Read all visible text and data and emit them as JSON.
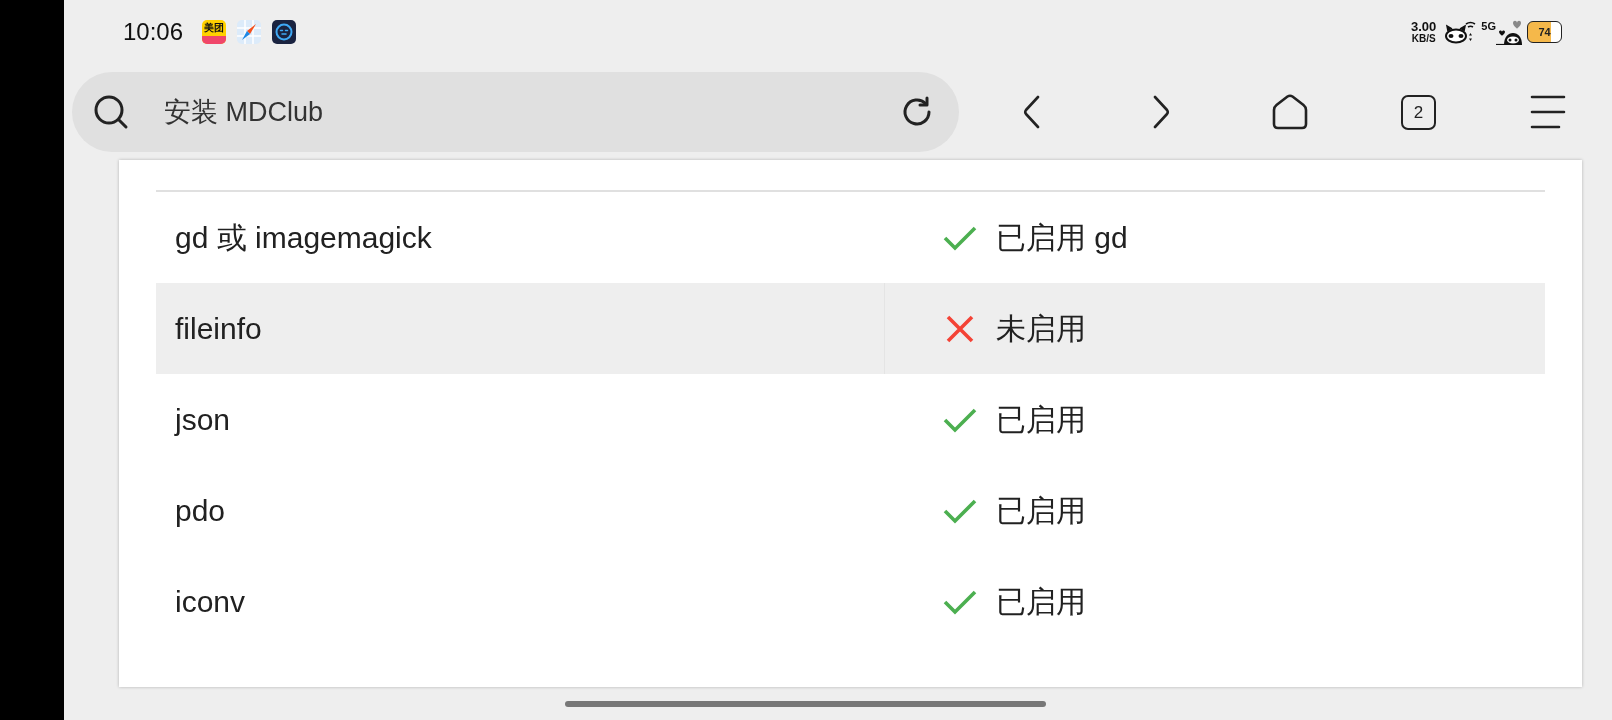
{
  "status_bar": {
    "time": "10:06",
    "notification_icons": [
      {
        "kind": "shop",
        "label": "美团"
      },
      {
        "kind": "compass"
      },
      {
        "kind": "chat"
      }
    ],
    "network_speed": {
      "value": "3.00",
      "unit": "KB/S"
    },
    "signal": {
      "label": "5G"
    },
    "battery": {
      "label": "74"
    }
  },
  "toolbar": {
    "address": {
      "value": "安装 MDClub"
    },
    "tab_count": "2"
  },
  "table": {
    "rows": [
      {
        "name": "gd 或 imagemagick",
        "enabled": true,
        "status": "已启用 gd",
        "highlighted": false
      },
      {
        "name": "fileinfo",
        "enabled": false,
        "status": "未启用",
        "highlighted": true
      },
      {
        "name": "json",
        "enabled": true,
        "status": "已启用",
        "highlighted": false
      },
      {
        "name": "pdo",
        "enabled": true,
        "status": "已启用",
        "highlighted": false
      },
      {
        "name": "iconv",
        "enabled": true,
        "status": "已启用",
        "highlighted": false
      }
    ]
  }
}
